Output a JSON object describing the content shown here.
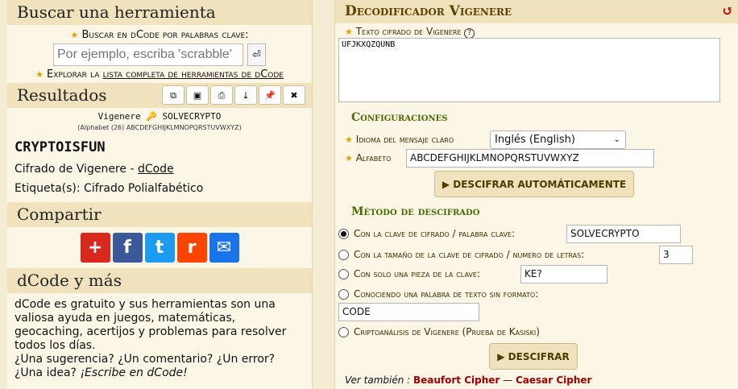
{
  "left": {
    "search_title": "Buscar una herramienta",
    "search_label": "Buscar en dCode por palabras clave:",
    "search_placeholder": "Por ejemplo, escriba 'scrabble'",
    "search_button": "⏎",
    "explore_prefix": "Explorar la ",
    "explore_link": "lista completa de herramientas de dCode",
    "results_title": "Resultados",
    "results_line1": "Vigenere 🔑 SOLVECRYPTO",
    "results_line2": "(Alphabet (26) ABCDEFGHIJKLMNOPQRSTUVWXYZ)",
    "result_value": "CRYPTOISFUN",
    "cipher_text_prefix": "Cifrado de Vigenere - ",
    "cipher_link": "dCode",
    "tag_line": "Etiqueta(s): Cifrado Polialfabético",
    "share_title": "Compartir",
    "share_buttons": [
      {
        "icon": "plus-share-icon",
        "glyph": "+",
        "color": "#d9281e"
      },
      {
        "icon": "facebook-icon",
        "glyph": "f",
        "color": "#3b5998"
      },
      {
        "icon": "twitter-icon",
        "glyph": "t",
        "color": "#1d9bf0"
      },
      {
        "icon": "reddit-icon",
        "glyph": "r",
        "color": "#ff4500"
      },
      {
        "icon": "email-icon",
        "glyph": "✉",
        "color": "#1a73e8"
      }
    ],
    "about_title": "dCode y más",
    "about_text1": "dCode es gratuito y sus herramientas son una valiosa ayuda en juegos, matemáticas, geocaching, acertijos y problemas para resolver todos los días.",
    "about_text2": "¿Una sugerencia? ¿Un comentario? ¿Un error? ¿Una idea? ",
    "about_text3": "¡Escribe en dCode!"
  },
  "right": {
    "title": "Decodificador Vigenere",
    "cipher_label": "Texto cifrado de Vigenere",
    "cipher_value": "UFJKXQZQUNB",
    "settings_title": "Configuraciones",
    "language_label": "Idioma del mensaje claro",
    "language_value": "Inglés (English)",
    "alphabet_label": "Alfabeto",
    "alphabet_value": "ABCDEFGHIJKLMNOPQRSTUVWXYZ",
    "auto_button": "▶ DESCIFRAR AUTOMÁTICAMENTE",
    "method_title": "Método de descifrado",
    "opt_key_label": "Con la clave de cifrado / palabra clave:",
    "opt_key_value": "SOLVECRYPTO",
    "opt_len_label": "Con la tamaño de la clave de cifrado / numero de letras:",
    "opt_len_value": "3",
    "opt_piece_label": "Con solo una pieza de la clave:",
    "opt_piece_value": "KE?",
    "opt_plain_label": "Conociendo una palabra de texto sin formato:",
    "opt_plain_value": "CODE",
    "opt_kasiski_label": "Criptoanálisis de Vigenere (Prueba de Kasiski)",
    "decrypt_button": "▶ DESCIFRAR",
    "see_also_prefix": "Ver también : ",
    "see_also_1": "Beaufort Cipher",
    "see_also_sep": " — ",
    "see_also_2": "Caesar Cipher"
  }
}
